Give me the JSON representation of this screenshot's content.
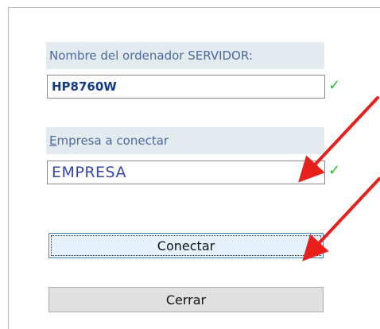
{
  "dialog": {
    "server_label": "Nombre del ordenador SERVIDOR:",
    "server_value": "HP8760W",
    "company_label_accesskey": "E",
    "company_label_rest": "mpresa a conectar",
    "company_value": "EMPRESA",
    "connect_button": "Conectar",
    "close_button": "Cerrar",
    "check_glyph": "✓"
  },
  "colors": {
    "label_bg": "#e3ebee",
    "label_text": "#4c6aa0",
    "check": "#2fb637",
    "annotation_arrow": "#e8201c"
  },
  "icons": [
    "check-icon",
    "red-arrow-annotation"
  ]
}
